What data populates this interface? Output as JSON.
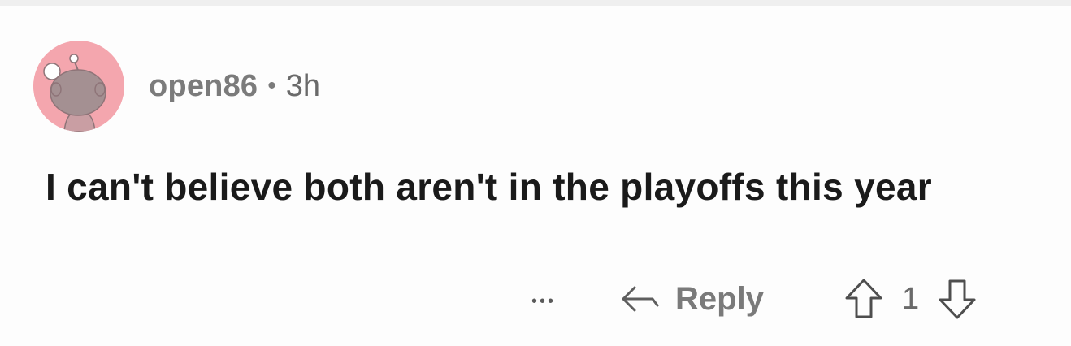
{
  "comment": {
    "username": "open86",
    "separator": "•",
    "time": "3h",
    "text": "I can't believe both aren't in the playoffs this year",
    "avatar_color": "#f4a6ae"
  },
  "actions": {
    "more_label": "•••",
    "more_icon": "more-dots-icon",
    "reply_label": "Reply",
    "reply_icon": "reply-arrow-icon",
    "upvote_icon": "upvote-arrow-icon",
    "downvote_icon": "downvote-arrow-icon",
    "vote_count": "1"
  }
}
